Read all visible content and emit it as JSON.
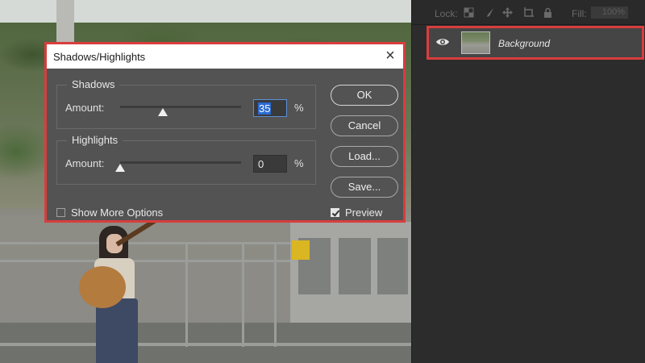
{
  "dialog": {
    "title": "Shadows/Highlights",
    "close_glyph": "×",
    "shadows": {
      "label": "Shadows",
      "amount_label": "Amount:",
      "value": "35",
      "unit": "%",
      "slider_fraction": 0.35
    },
    "highlights": {
      "label": "Highlights",
      "amount_label": "Amount:",
      "value": "0",
      "unit": "%",
      "slider_fraction": 0.0
    },
    "buttons": {
      "ok": "OK",
      "cancel": "Cancel",
      "load": "Load...",
      "save": "Save..."
    },
    "show_more_options": {
      "label": "Show More Options",
      "checked": false
    },
    "preview": {
      "label": "Preview",
      "checked": true
    },
    "highlight_color": "#d93d3d"
  },
  "layers_panel": {
    "lock_label": "Lock:",
    "lock_icons": [
      "lock-transparent-icon",
      "lock-paint-icon",
      "lock-move-icon",
      "lock-artboard-icon",
      "lock-all-icon"
    ],
    "fill_label": "Fill:",
    "fill_value": "100%",
    "layer": {
      "name": "Background",
      "visible": true,
      "icon": "eye-icon"
    }
  }
}
